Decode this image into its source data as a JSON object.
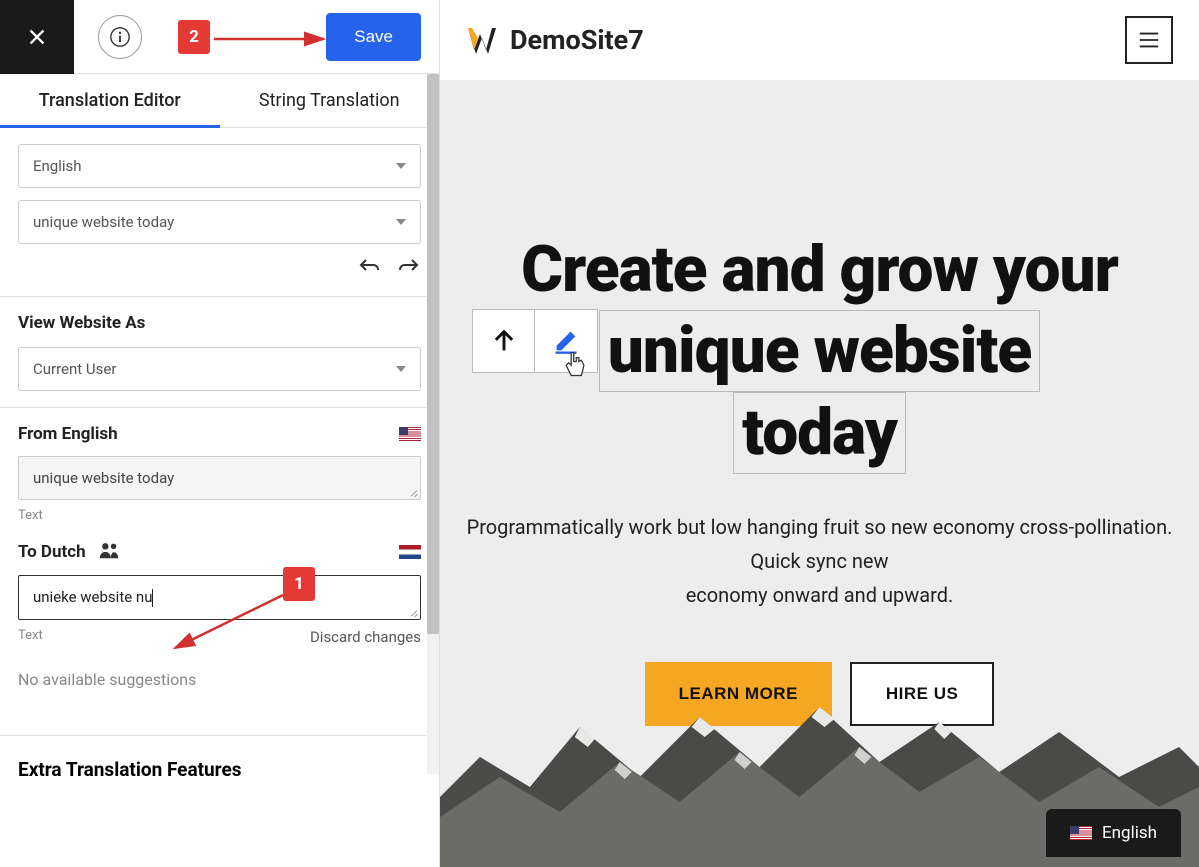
{
  "topbar": {
    "save_label": "Save"
  },
  "tabs": {
    "editor": "Translation Editor",
    "string": "String Translation"
  },
  "lang_select": "English",
  "string_select": "unique website today",
  "view_as": {
    "title": "View Website As",
    "value": "Current User"
  },
  "from": {
    "label": "From English",
    "value": "unique website today",
    "meta": "Text"
  },
  "to": {
    "label": "To Dutch",
    "value": "unieke website nu",
    "meta": "Text",
    "discard": "Discard changes"
  },
  "suggestions": "No available suggestions",
  "extras_title": "Extra Translation Features",
  "preview": {
    "site_title": "DemoSite7",
    "hero_line1": "Create and grow your",
    "hero_line2": "unique website",
    "hero_line3": "today",
    "sub_line1": "Programmatically work but low hanging fruit so new economy cross-pollination.",
    "sub_line2": "Quick sync new",
    "sub_line3": "economy onward and upward.",
    "cta_primary": "LEARN MORE",
    "cta_secondary": "HIRE US",
    "lang_switcher": "English"
  },
  "annotations": {
    "badge1": "1",
    "badge2": "2"
  }
}
